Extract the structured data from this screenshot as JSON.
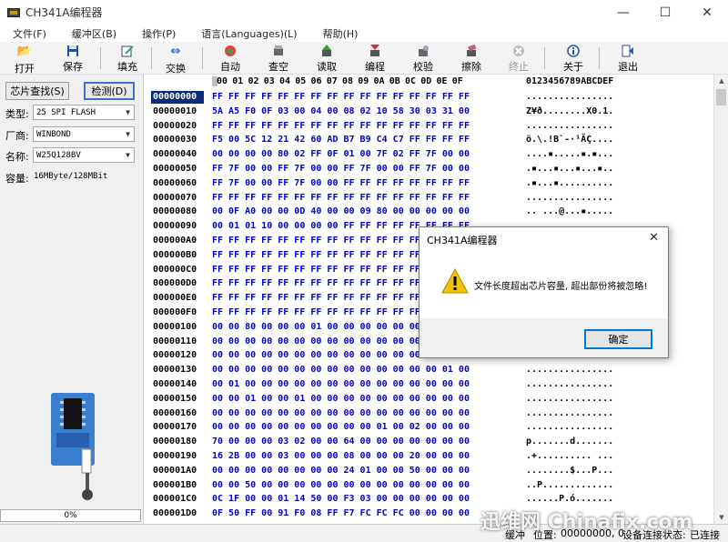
{
  "window": {
    "title": "CH341A编程器",
    "minimize": "—",
    "maximize": "☐",
    "close": "✕"
  },
  "menu": [
    "文件(F)",
    "缓冲区(B)",
    "操作(P)",
    "语言(Languages)(L)",
    "帮助(H)"
  ],
  "toolbar": {
    "open": "打开",
    "save": "保存",
    "fill": "填充",
    "swap": "交换",
    "auto": "自动",
    "blank": "查空",
    "read": "读取",
    "program": "编程",
    "verify": "校验",
    "erase": "擦除",
    "stop": "终止",
    "about": "关于",
    "exit": "退出"
  },
  "left_panel": {
    "find_chip": "芯片查找(S)",
    "detect": "检测(D)",
    "type_label": "类型:",
    "type_value": "25 SPI FLASH",
    "vendor_label": "厂商:",
    "vendor_value": "WINBOND",
    "name_label": "名称:",
    "name_value": "W25Q128BV",
    "capacity_label": "容量:",
    "capacity_value": "16MByte/128MBit",
    "progress": "0%"
  },
  "hex_header": {
    "columns": [
      "00",
      "01",
      "02",
      "03",
      "04",
      "05",
      "06",
      "07",
      "08",
      "09",
      "0A",
      "0B",
      "0C",
      "0D",
      "0E",
      "0F"
    ],
    "ascii_header": "0123456789ABCDEF"
  },
  "hex_rows": [
    {
      "addr": "00000000",
      "hex": "FF FF FF FF FF FF FF FF FF FF FF FF FF FF FF FF",
      "ascii": "................"
    },
    {
      "addr": "00000010",
      "hex": "5A A5 F0 0F 03 00 04 00 08 02 10 58 30 03 31 00",
      "ascii": "Z¥ð........X0.1."
    },
    {
      "addr": "00000020",
      "hex": "FF FF FF FF FF FF FF FF FF FF FF FF FF FF FF FF",
      "ascii": "................"
    },
    {
      "addr": "00000030",
      "hex": "F5 00 5C 12 21 42 60 AD B7 B9 C4 C7 FF FF FF FF",
      "ascii": "õ.\\.!B`-·¹ÄÇ...."
    },
    {
      "addr": "00000040",
      "hex": "00 00 00 00 80 02 FF 0F 01 00 7F 02 FF 7F 00 00",
      "ascii": "....▪.....▪.▪..."
    },
    {
      "addr": "00000050",
      "hex": "FF 7F 00 00 FF 7F 00 00 FF 7F 00 00 FF 7F 00 00",
      "ascii": ".▪...▪...▪...▪.."
    },
    {
      "addr": "00000060",
      "hex": "FF 7F 00 00 FF 7F 00 00 FF FF FF FF FF FF FF FF",
      "ascii": ".▪...▪.........."
    },
    {
      "addr": "00000070",
      "hex": "FF FF FF FF FF FF FF FF FF FF FF FF FF FF FF FF",
      "ascii": "................"
    },
    {
      "addr": "00000080",
      "hex": "00 0F A0 00 00 0D 40 00 00 09 80 00 00 00 00 00",
      "ascii": ".. ...@...▪....."
    },
    {
      "addr": "00000090",
      "hex": "00 01 01 10 00 00 00 00 FF FF FF FF FF FF FF FF",
      "ascii": ""
    },
    {
      "addr": "000000A0",
      "hex": "FF FF FF FF FF FF FF FF FF FF FF FF FF FF FF FF",
      "ascii": ""
    },
    {
      "addr": "000000B0",
      "hex": "FF FF FF FF FF FF FF FF FF FF FF FF FF FF FF FF",
      "ascii": ""
    },
    {
      "addr": "000000C0",
      "hex": "FF FF FF FF FF FF FF FF FF FF FF FF FF FF FF FF",
      "ascii": ""
    },
    {
      "addr": "000000D0",
      "hex": "FF FF FF FF FF FF FF FF FF FF FF FF FF FF FF FF",
      "ascii": ""
    },
    {
      "addr": "000000E0",
      "hex": "FF FF FF FF FF FF FF FF FF FF FF FF FF FF FF FF",
      "ascii": ""
    },
    {
      "addr": "000000F0",
      "hex": "FF FF FF FF FF FF FF FF FF FF FF FF FF FF FF FF",
      "ascii": ""
    },
    {
      "addr": "00000100",
      "hex": "00 00 80 00 00 00 01 00 00 00 00 00 00 00 00 00",
      "ascii": ""
    },
    {
      "addr": "00000110",
      "hex": "00 00 00 00 00 00 00 00 00 00 00 00 00 00 00 00",
      "ascii": ""
    },
    {
      "addr": "00000120",
      "hex": "00 00 00 00 00 00 00 00 00 00 00 00 00 00 00 00",
      "ascii": ""
    },
    {
      "addr": "00000130",
      "hex": "00 00 00 00 00 00 00 00 00 00 00 00 00 00 01 00",
      "ascii": "................"
    },
    {
      "addr": "00000140",
      "hex": "00 01 00 00 00 00 00 00 00 00 00 00 00 00 00 00",
      "ascii": "................"
    },
    {
      "addr": "00000150",
      "hex": "00 00 01 00 00 01 00 00 00 00 00 00 00 00 00 00",
      "ascii": "................"
    },
    {
      "addr": "00000160",
      "hex": "00 00 00 00 00 00 00 00 00 00 00 00 00 00 00 00",
      "ascii": "................"
    },
    {
      "addr": "00000170",
      "hex": "00 00 00 00 00 00 00 00 00 00 01 00 02 00 00 00",
      "ascii": "................"
    },
    {
      "addr": "00000180",
      "hex": "70 00 00 00 03 02 00 00 64 00 00 00 00 00 00 00",
      "ascii": "p.......d......."
    },
    {
      "addr": "00000190",
      "hex": "16 2B 00 00 03 00 00 00 08 00 00 00 20 00 00 00",
      "ascii": ".+.......... ..."
    },
    {
      "addr": "000001A0",
      "hex": "00 00 00 00 00 00 00 00 24 01 00 00 50 00 00 00",
      "ascii": "........$...P..."
    },
    {
      "addr": "000001B0",
      "hex": "00 00 50 00 00 00 00 00 00 00 00 00 00 00 00 00",
      "ascii": "..P............."
    },
    {
      "addr": "000001C0",
      "hex": "0C 1F 00 00 01 14 50 00 F3 03 00 00 00 00 00 00",
      "ascii": "......P.ó......."
    },
    {
      "addr": "000001D0",
      "hex": "0F 50 FF 00 91 F0 08 FF F7 FC FC FC 00 00 00 00",
      "ascii": ""
    }
  ],
  "status": {
    "buffer": "缓冲",
    "position_label": "位置:",
    "position_value": "00000000, 0",
    "device_label": "设备连接状态:",
    "device_value": "已连接"
  },
  "dialog": {
    "title": "CH341A编程器",
    "close": "✕",
    "message": "文件长度超出芯片容量, 超出部份将被忽略!",
    "ok": "确定"
  },
  "watermark": "迅维网 Chinafix.com"
}
